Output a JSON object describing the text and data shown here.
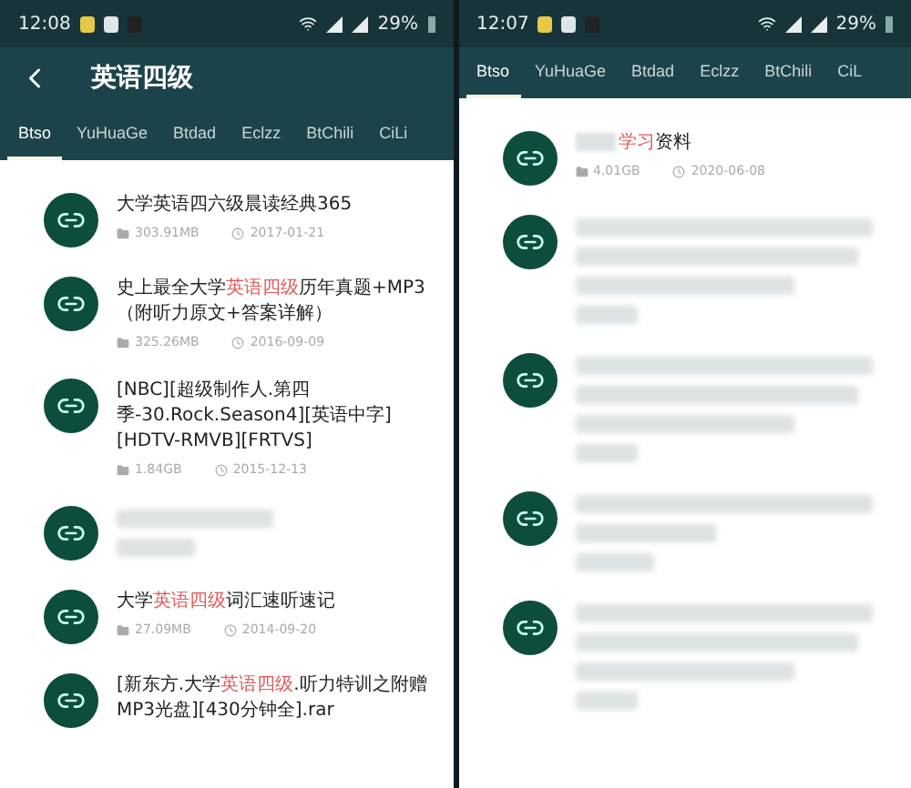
{
  "phones": [
    {
      "status": {
        "time": "12:08",
        "battery": "29%"
      },
      "back": true,
      "title": "英语四级",
      "tabs": [
        {
          "label": "Btso",
          "selected": true
        },
        {
          "label": "YuHuaGe",
          "selected": false
        },
        {
          "label": "Btdad",
          "selected": false
        },
        {
          "label": "Eclzz",
          "selected": false
        },
        {
          "label": "BtChili",
          "selected": false
        },
        {
          "label": "CiLi",
          "selected": false
        }
      ],
      "items": [
        {
          "kind": "text",
          "title": [
            {
              "text": "大学英语四六级晨读经典365",
              "highlight": false
            }
          ],
          "size": "303.91MB",
          "date": "2017-01-21"
        },
        {
          "kind": "text",
          "title": [
            {
              "text": "史上最全大学",
              "highlight": false
            },
            {
              "text": "英语四级",
              "highlight": true
            },
            {
              "text": "历年真题+MP3（附听力原文+答案详解）",
              "highlight": false
            }
          ],
          "size": "325.26MB",
          "date": "2016-09-09"
        },
        {
          "kind": "text",
          "title": [
            {
              "text": "[NBC][超级制作人.第四季-30.Rock.Season4][英语中字][HDTV-RMVB][FRTVS]",
              "highlight": false
            }
          ],
          "size": "1.84GB",
          "date": "2015-12-13"
        },
        {
          "kind": "blurred-short"
        },
        {
          "kind": "text",
          "title": [
            {
              "text": "大学",
              "highlight": false
            },
            {
              "text": "英语四级",
              "highlight": true
            },
            {
              "text": "词汇速听速记",
              "highlight": false
            }
          ],
          "size": "27.09MB",
          "date": "2014-09-20"
        },
        {
          "kind": "text",
          "title": [
            {
              "text": "[新东方.大学",
              "highlight": false
            },
            {
              "text": "英语四级",
              "highlight": true
            },
            {
              "text": ".听力特训之附赠MP3光盘][430分钟全].rar",
              "highlight": false
            }
          ]
        }
      ]
    },
    {
      "status": {
        "time": "12:07",
        "battery": "29%"
      },
      "tabs": [
        {
          "label": "Btso",
          "selected": true
        },
        {
          "label": "YuHuaGe",
          "selected": false
        },
        {
          "label": "Btdad",
          "selected": false
        },
        {
          "label": "Eclzz",
          "selected": false
        },
        {
          "label": "BtChili",
          "selected": false
        },
        {
          "label": "CiL",
          "selected": false
        }
      ],
      "items": [
        {
          "kind": "text",
          "blurred_prefix": true,
          "title": [
            {
              "text": "学习",
              "highlight": true
            },
            {
              "text": "资料",
              "highlight": false
            }
          ],
          "size": "4.01GB",
          "date": "2020-06-08"
        },
        {
          "kind": "blurred-long"
        },
        {
          "kind": "blurred-long"
        },
        {
          "kind": "blurred-medium"
        },
        {
          "kind": "blurred-long"
        }
      ]
    }
  ]
}
